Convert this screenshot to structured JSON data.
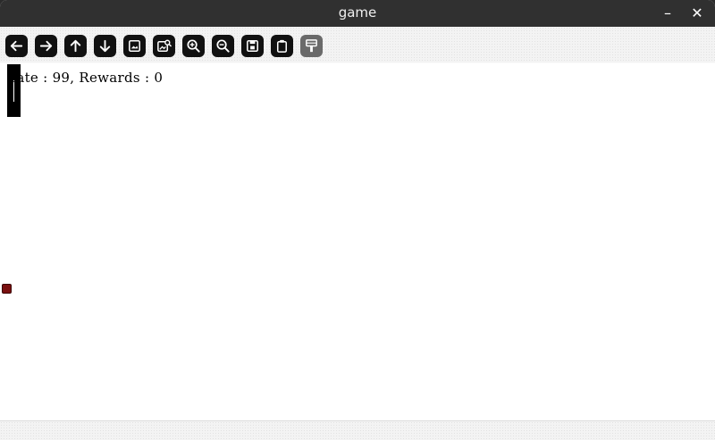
{
  "window": {
    "title": "game",
    "minimize_glyph": "–",
    "close_glyph": "✕"
  },
  "toolbar": {
    "tools": [
      {
        "name": "back-icon"
      },
      {
        "name": "forward-icon"
      },
      {
        "name": "arrow-up-icon"
      },
      {
        "name": "arrow-down-icon"
      },
      {
        "name": "image-icon"
      },
      {
        "name": "image-search-icon"
      },
      {
        "name": "zoom-in-icon"
      },
      {
        "name": "zoom-out-icon"
      },
      {
        "name": "save-icon"
      },
      {
        "name": "clipboard-icon"
      },
      {
        "name": "paint-brush-icon"
      }
    ]
  },
  "game": {
    "status_text": "tate : 99, Rewards : 0"
  },
  "colors": {
    "titlebar": "#303030",
    "toolbar_button": "#111111",
    "ball": "#7a1010",
    "paddle": "#000000"
  }
}
